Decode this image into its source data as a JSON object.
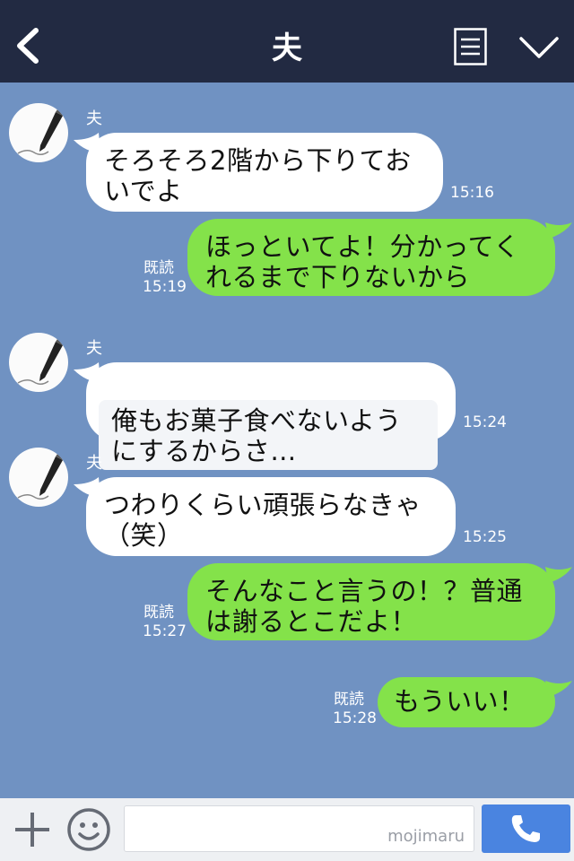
{
  "header": {
    "title": "夫",
    "back_icon": "back-chevron-icon",
    "menu_icon": "notes-menu-icon",
    "collapse_icon": "chevron-down-icon"
  },
  "messages": [
    {
      "direction": "in",
      "sender": "夫",
      "text": "そろそろ2階から下りてお\nいでよ",
      "time": "15:16"
    },
    {
      "direction": "out",
      "read": "既読",
      "text": "ほっといてよ！分かってく\nれるまで下りないから",
      "time": "15:19"
    },
    {
      "direction": "in",
      "sender": "夫",
      "text": "俺もお菓子食べないよう\nにするからさ…",
      "time": "15:24"
    },
    {
      "direction": "in",
      "sender": "夫",
      "text": "つわりくらい頑張らなきゃ\n（笑）",
      "time": "15:25"
    },
    {
      "direction": "out",
      "read": "既読",
      "text": "そんなこと言うの！？普通\nは謝るとこだよ！",
      "time": "15:27"
    },
    {
      "direction": "out",
      "read": "既読",
      "text": "もういい！",
      "time": "15:28"
    }
  ],
  "footer": {
    "watermark": "mojimaru",
    "input_value": "",
    "plus_icon": "plus-icon",
    "sticker_icon": "smile-icon",
    "call_icon": "phone-icon"
  },
  "colors": {
    "header_bg": "#222a42",
    "chat_bg": "#7092c2",
    "incoming_bubble": "#ffffff",
    "outgoing_bubble": "#84e24a",
    "send_button": "#4a84e0"
  }
}
